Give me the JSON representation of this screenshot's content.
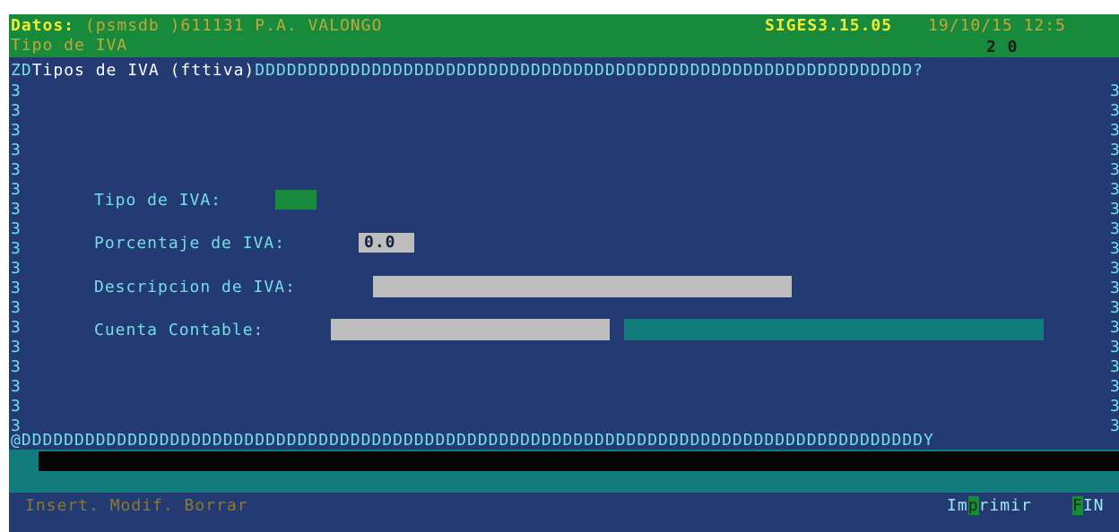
{
  "header": {
    "datos_label": "Datos:",
    "db": "(psmsdb",
    "company": ")611131 P.A. VALONGO",
    "version": "SIGES3.15.05",
    "datetime": "19/10/15 12:5",
    "screen_title": "Tipo de IVA",
    "counter": "2 0"
  },
  "window": {
    "top_border_prefix": "ZD",
    "title": "Tipos de IVA (fttiva)",
    "top_border_fill": "DDDDDDDDDDDDDDDDDDDDDDDDDDDDDDDDDDDDDDDDDDDDDDDDDDDDDDDDDDDDDD?",
    "side_char": "3",
    "bottom_border": "@DDDDDDDDDDDDDDDDDDDDDDDDDDDDDDDDDDDDDDDDDDDDDDDDDDDDDDDDDDDDDDDDDDDDDDDDDDDDDDDDDDDDDY"
  },
  "form": {
    "tipo_label": "Tipo de IVA:",
    "tipo_value": "",
    "porcentaje_label": "Porcentaje de IVA:",
    "porcentaje_value": "0.0",
    "descripcion_label": "Descripcion de IVA:",
    "descripcion_value": "",
    "cuenta_label": "Cuenta Contable:",
    "cuenta_value": "",
    "cuenta_desc_value": ""
  },
  "status_bar": {
    "actions": "Insert. Modif. Borrar",
    "imprimir_pre": "Im",
    "imprimir_key": "p",
    "imprimir_post": "rimir",
    "fin_key": "F",
    "fin_post": "IN"
  },
  "colors": {
    "background": "#233b72",
    "header_green": "#178a3c",
    "label_cyan": "#73dfe8",
    "teal": "#127c7c",
    "field_gray": "#bdbdbd"
  }
}
